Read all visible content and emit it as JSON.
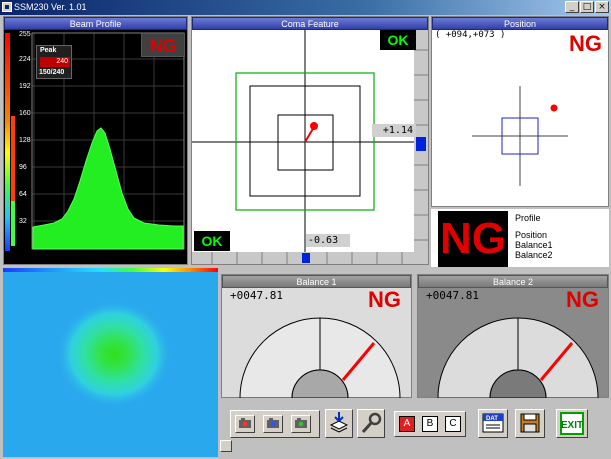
{
  "window": {
    "title": "SSM230 Ver. 1.01"
  },
  "beam_profile": {
    "title": "Beam Profile",
    "status": "NG",
    "peak_label": "Peak",
    "peak_value": "240",
    "peak_ratio": "150/240",
    "y_ticks": [
      "255",
      "224",
      "192",
      "160",
      "128",
      "96",
      "64",
      "32"
    ]
  },
  "coma": {
    "title": "Coma Feature",
    "status_top": "OK",
    "status_bottom": "OK",
    "y_value": "+1.14",
    "x_value": "-0.63"
  },
  "position": {
    "title": "Position",
    "coords": "( +094,+073 )",
    "status": "NG"
  },
  "summary": {
    "status": "NG",
    "items": [
      "Profile",
      "Position",
      "Balance1",
      "Balance2"
    ]
  },
  "balance1": {
    "title": "Balance 1",
    "value": "+0047.81",
    "status": "NG"
  },
  "balance2": {
    "title": "Balance 2",
    "value": "+0047.81",
    "status": "NG"
  },
  "toolbar": {
    "letters": [
      "A",
      "B",
      "C"
    ],
    "dat_label": "DAT",
    "exit_label": "EXIT"
  },
  "colors": {
    "ng": "#e00000",
    "ok": "#00ff00",
    "gauge_needle": "#ff0000",
    "title_blue": "#3340a8"
  }
}
